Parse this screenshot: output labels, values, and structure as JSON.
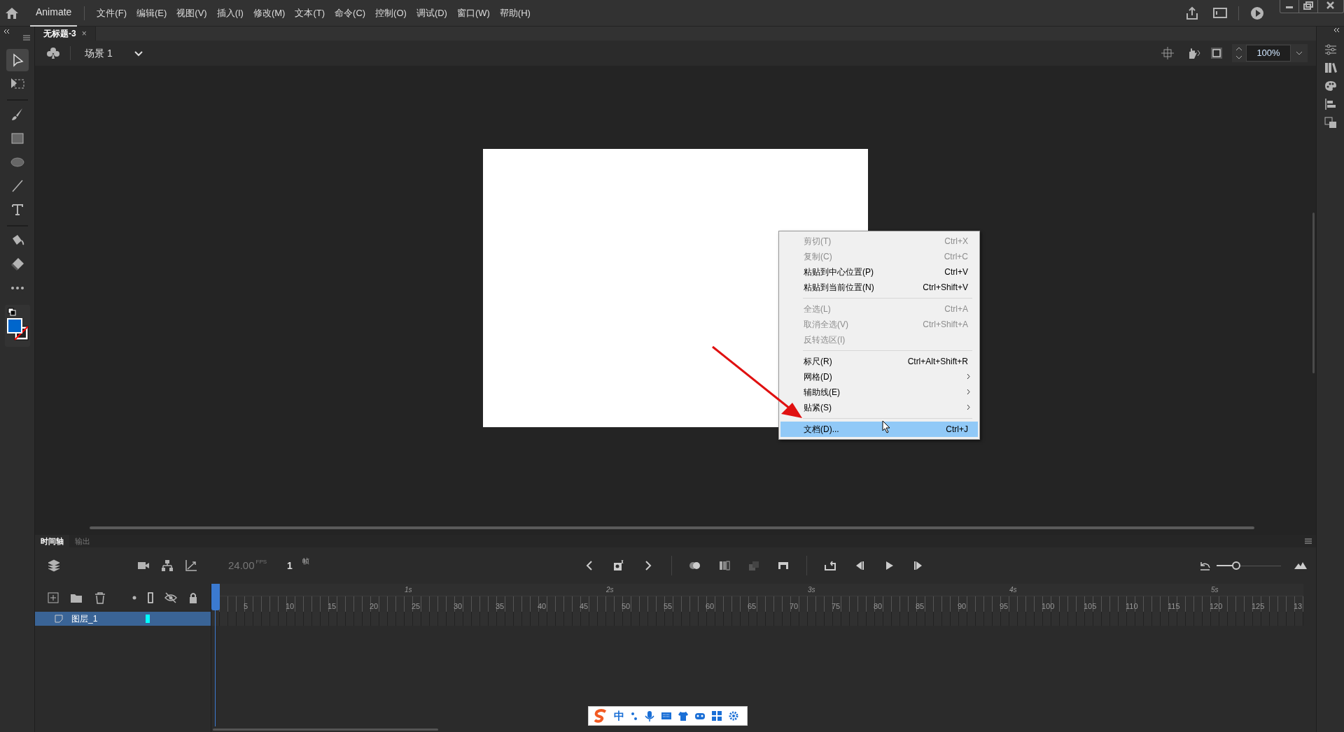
{
  "app": {
    "name": "Animate"
  },
  "menu": [
    "文件(F)",
    "编辑(E)",
    "视图(V)",
    "插入(I)",
    "修改(M)",
    "文本(T)",
    "命令(C)",
    "控制(O)",
    "调试(D)",
    "窗口(W)",
    "帮助(H)"
  ],
  "document_tab": {
    "title": "无标题-3",
    "close": "×"
  },
  "scene": {
    "label": "场景 1"
  },
  "zoom": {
    "value": "100%"
  },
  "tools": [
    {
      "kind": "select",
      "selected": true
    },
    {
      "kind": "subselect",
      "selected": false
    },
    {
      "kind": "sep"
    },
    {
      "kind": "brush",
      "selected": false
    },
    {
      "kind": "rect",
      "selected": false
    },
    {
      "kind": "oval",
      "selected": false
    },
    {
      "kind": "line",
      "selected": false
    },
    {
      "kind": "text",
      "selected": false
    },
    {
      "kind": "sep"
    },
    {
      "kind": "bucket",
      "selected": false
    },
    {
      "kind": "eraser",
      "selected": false
    },
    {
      "kind": "more",
      "selected": false
    }
  ],
  "context_menu": [
    [
      {
        "label": "剪切(T)",
        "shortcut": "Ctrl+X",
        "disabled": true,
        "submenu": false,
        "selected": false
      },
      {
        "label": "复制(C)",
        "shortcut": "Ctrl+C",
        "disabled": true,
        "submenu": false,
        "selected": false
      },
      {
        "label": "粘贴到中心位置(P)",
        "shortcut": "Ctrl+V",
        "disabled": false,
        "submenu": false,
        "selected": false
      },
      {
        "label": "粘贴到当前位置(N)",
        "shortcut": "Ctrl+Shift+V",
        "disabled": false,
        "submenu": false,
        "selected": false
      }
    ],
    [
      {
        "label": "全选(L)",
        "shortcut": "Ctrl+A",
        "disabled": true,
        "submenu": false,
        "selected": false
      },
      {
        "label": "取消全选(V)",
        "shortcut": "Ctrl+Shift+A",
        "disabled": true,
        "submenu": false,
        "selected": false
      },
      {
        "label": "反转选区(I)",
        "disabled": true,
        "submenu": false,
        "selected": false
      }
    ],
    [
      {
        "label": "标尺(R)",
        "shortcut": "Ctrl+Alt+Shift+R",
        "disabled": false,
        "submenu": false,
        "selected": false
      },
      {
        "label": "网格(D)",
        "disabled": false,
        "submenu": true,
        "selected": false
      },
      {
        "label": "辅助线(E)",
        "disabled": false,
        "submenu": true,
        "selected": false
      },
      {
        "label": "贴紧(S)",
        "disabled": false,
        "submenu": true,
        "selected": false
      }
    ],
    [
      {
        "label": "文档(D)...",
        "shortcut": "Ctrl+J",
        "disabled": false,
        "submenu": false,
        "selected": true
      }
    ]
  ],
  "timeline": {
    "tabs": [
      {
        "label": "时间轴",
        "selected": true
      },
      {
        "label": "输出",
        "selected": false
      }
    ],
    "zoom_slider": {
      "level": 0.3
    },
    "fps": "24.00",
    "fps_unit": "FPS",
    "frame": "1",
    "frame_unit": "帧",
    "seconds": [
      "1s",
      "2s",
      "3s",
      "4s",
      "5s"
    ],
    "frame_numbers": [
      "5",
      "10",
      "15",
      "20",
      "25",
      "30",
      "35",
      "40",
      "45",
      "50",
      "55",
      "60",
      "65",
      "70",
      "75",
      "80",
      "85",
      "90",
      "95",
      "100",
      "105",
      "110",
      "115",
      "120",
      "125",
      "13"
    ],
    "layers": [
      {
        "name": "图层_1",
        "selected": true,
        "color": "#00ffff"
      }
    ]
  },
  "ime_bar": {
    "mode": "中"
  }
}
